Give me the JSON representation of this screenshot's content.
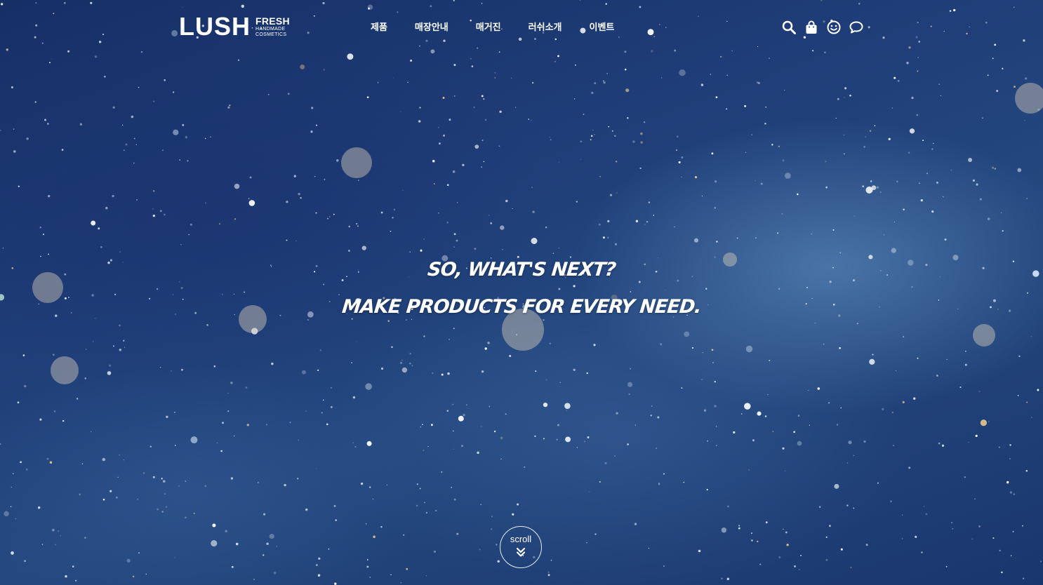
{
  "brand": {
    "name": "LUSH",
    "tagline_1": "FRESH",
    "tagline_2": "HANDMADE",
    "tagline_3": "COSMETICS"
  },
  "nav": {
    "items": [
      {
        "label": "제품"
      },
      {
        "label": "매장안내"
      },
      {
        "label": "매거진"
      },
      {
        "label": "러쉬소개"
      },
      {
        "label": "이벤트"
      }
    ]
  },
  "utilities": [
    {
      "icon": "search-icon"
    },
    {
      "icon": "shopping-bag-icon"
    },
    {
      "icon": "smiley-icon"
    },
    {
      "icon": "chat-bubble-icon"
    }
  ],
  "hero": {
    "line1": "SO, WHAT'S NEXT?",
    "line2": "MAKE PRODUCTS FOR EVERY NEED."
  },
  "scroll": {
    "label": "scroll",
    "icon": "double-chevron-down-icon"
  },
  "colors": {
    "background": "#1b3569",
    "text": "#ffffff"
  }
}
